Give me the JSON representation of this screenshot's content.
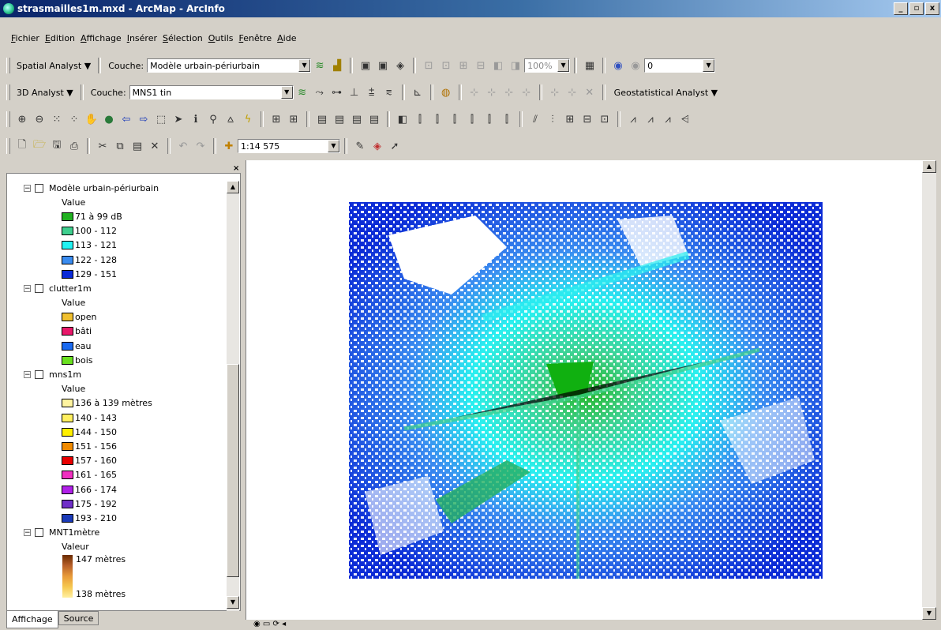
{
  "window": {
    "title": "strasmailles1m.mxd - ArcMap - ArcInfo",
    "buttons": [
      "_",
      "▫",
      "x"
    ]
  },
  "menu": [
    "Fichier",
    "Edition",
    "Affichage",
    "Insérer",
    "Sélection",
    "Outils",
    "Fenêtre",
    "Aide"
  ],
  "spatial_analyst": {
    "label": "Spatial Analyst",
    "layer_label": "Couche:",
    "layer_value": "Modèle urbain-périurbain",
    "zoom_value": "100%",
    "number_value": "0"
  },
  "analyst_3d": {
    "label": "3D Analyst",
    "layer_label": "Couche:",
    "layer_value": "MNS1 tin",
    "geostat_label": "Geostatistical Analyst"
  },
  "standard": {
    "scale_value": "1:14 575"
  },
  "toc": {
    "layers": [
      {
        "name": "Modèle urbain-périurbain",
        "value_heading": "Value",
        "items": [
          {
            "label": "71 à 99 dB",
            "color": "#21b121"
          },
          {
            "label": "100 - 112",
            "color": "#3ecf8e"
          },
          {
            "label": "113 - 121",
            "color": "#22f2f2"
          },
          {
            "label": "122 - 128",
            "color": "#3a8cf0"
          },
          {
            "label": "129 - 151",
            "color": "#0a2ad8"
          }
        ]
      },
      {
        "name": "clutter1m",
        "value_heading": "Value",
        "items": [
          {
            "label": "open",
            "color": "#f0c030"
          },
          {
            "label": "bâti",
            "color": "#e8186a"
          },
          {
            "label": "eau",
            "color": "#1a6af0"
          },
          {
            "label": "bois",
            "color": "#6ae020"
          }
        ]
      },
      {
        "name": "mns1m",
        "value_heading": "Value",
        "items": [
          {
            "label": "136 à 139 mètres",
            "color": "#fff4a0"
          },
          {
            "label": "140 - 143",
            "color": "#fff060"
          },
          {
            "label": "144 - 150",
            "color": "#fff000"
          },
          {
            "label": "151 - 156",
            "color": "#f08a00"
          },
          {
            "label": "157 - 160",
            "color": "#e80000"
          },
          {
            "label": "161 - 165",
            "color": "#f030c0"
          },
          {
            "label": "166 - 174",
            "color": "#b020e8"
          },
          {
            "label": "175 - 192",
            "color": "#7030c8"
          },
          {
            "label": "193 - 210",
            "color": "#1a3ab8"
          }
        ]
      }
    ],
    "mnt": {
      "name": "MNT1mètre",
      "value_heading": "Valeur",
      "high": "147 mètres",
      "low": "138 mètres"
    }
  },
  "tabs": [
    "Affichage",
    "Source"
  ]
}
